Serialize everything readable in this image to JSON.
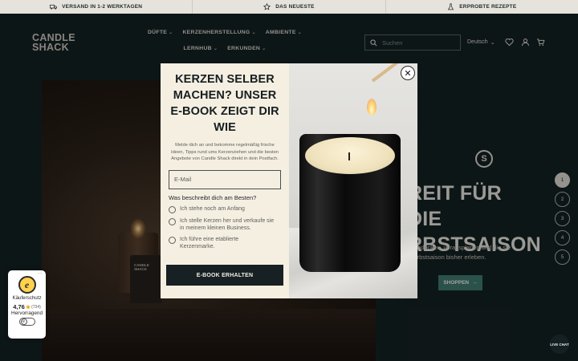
{
  "topbar": {
    "items": [
      {
        "label": "VERSAND IN 1-2 WERKTAGEN",
        "icon": "truck-icon"
      },
      {
        "label": "DAS NEUESTE",
        "icon": "star-icon"
      },
      {
        "label": "ERPROBTE REZEPTE",
        "icon": "flask-icon"
      }
    ]
  },
  "header": {
    "logo_line1": "CANDLE",
    "logo_line2": "SHACK",
    "nav": [
      {
        "label": "DÜFTE"
      },
      {
        "label": "KERZENHERSTELLUNG"
      },
      {
        "label": "AMBIENTE"
      },
      {
        "label": "LERNHUB"
      },
      {
        "label": "ERKUNDEN"
      }
    ],
    "search_placeholder": "Suchen",
    "language": "Deutsch"
  },
  "hero": {
    "candle_label": "CANDLE\nSHACK",
    "headline": "REIT FÜR DIE\nRBSTSAISON",
    "subtext": "t eindecken, vorausplanen und die ste Herbstsaison bisher erleben.",
    "button_label": "SHOPPEN",
    "slides": [
      "1",
      "2",
      "3",
      "4",
      "5"
    ],
    "active_slide": 1
  },
  "modal": {
    "title": "KERZEN SELBER MACHEN? UNSER E-BOOK ZEIGT DIR WIE",
    "description": "Melde dich an und bekomme regelmäßig frische Ideen, Tipps rund ums Kerzenziehen und die besten Angebote von Candle Shack direkt in dein Postfach.",
    "email_placeholder": "E-Mail",
    "question": "Was beschreibt dich am Besten?",
    "options": [
      "Ich stehe noch am Anfang",
      "Ich stelle Kerzen her und verkaufe sie in meinem kleinen Business.",
      "Ich führe eine etablierte Kerzenmarke."
    ],
    "submit_label": "E-BOOK ERHALTEN",
    "close_symbol": "✕"
  },
  "trust_badge": {
    "menu": "···",
    "seal_letter": "e",
    "label": "Käuferschutz",
    "rating": "4,76",
    "count": "(734)",
    "verdict": "Hervorragend",
    "toggle_letter": "e"
  },
  "livechat": {
    "label": "LIVE CHAT"
  },
  "colors": {
    "background": "#142122",
    "topbar": "#e6e3dc",
    "modal": "#f5efe2",
    "button_dark": "#172123",
    "accent_green": "#3f7a6e"
  }
}
